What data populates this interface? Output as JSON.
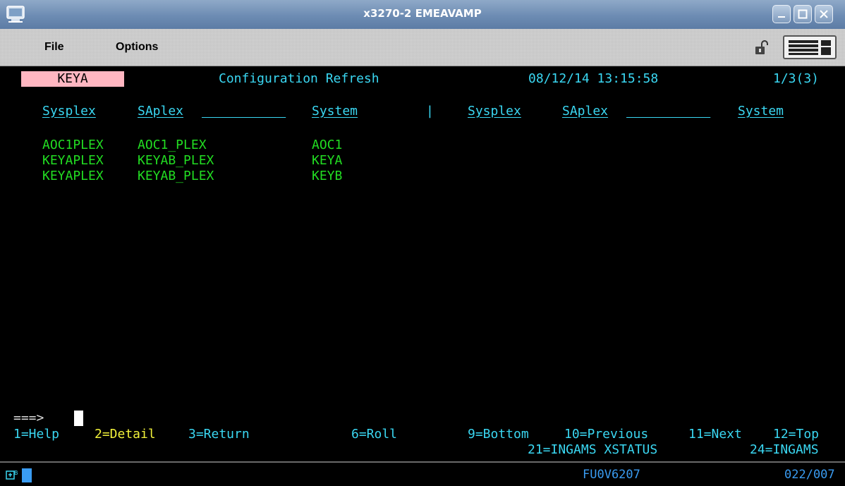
{
  "window": {
    "title": "x3270-2 EMEAVAMP"
  },
  "menubar": {
    "items": [
      "File",
      "Options"
    ]
  },
  "terminal": {
    "system_id": "KEYA",
    "screen_title": "Configuration Refresh",
    "datetime": "08/12/14 13:15:58",
    "page_info": "1/3(3)",
    "columns_left": [
      "Sysplex",
      "SAplex",
      "System"
    ],
    "separator": "|",
    "columns_right": [
      "Sysplex",
      "SAplex",
      "System"
    ],
    "rows": [
      {
        "sysplex": "AOC1PLEX",
        "saplex": "AOC1_PLEX",
        "system": "AOC1"
      },
      {
        "sysplex": "KEYAPLEX",
        "saplex": "KEYAB_PLEX",
        "system": "KEYA"
      },
      {
        "sysplex": "KEYAPLEX",
        "saplex": "KEYAB_PLEX",
        "system": "KEYB"
      }
    ],
    "command_prompt": "===>",
    "pfkeys_row1": {
      "help": "1=Help",
      "detail": "2=Detail",
      "return": "3=Return",
      "roll": "6=Roll",
      "bottom": "9=Bottom",
      "previous": "10=Previous",
      "next": "11=Next",
      "top": "12=Top"
    },
    "pfkeys_row2": {
      "ingams_xstatus": "21=INGAMS XSTATUS",
      "ingams": "24=INGAMS"
    }
  },
  "statusbar": {
    "terminal_id": "FU0V6207",
    "cursor_pos": "022/007"
  },
  "colors": {
    "field_green": "#22dd22",
    "pfkey_cyan": "#3ad7f2",
    "pfkey_yellow": "#f2f23a",
    "system_highlight": "#ffb6c1",
    "titlebar": "#6d8cb3"
  }
}
